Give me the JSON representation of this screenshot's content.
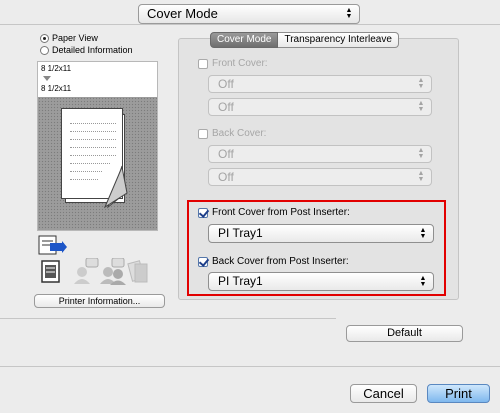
{
  "top_select": {
    "value": "Cover Mode"
  },
  "left": {
    "view_options": [
      {
        "label": "Paper View",
        "selected": true
      },
      {
        "label": "Detailed Information",
        "selected": false
      }
    ],
    "paper_size_1": "8 1/2x11",
    "paper_size_2": "8 1/2x11",
    "printer_info_button": "Printer Information..."
  },
  "tabs": [
    {
      "label": "Cover Mode",
      "selected": true
    },
    {
      "label": "Transparency Interleave",
      "selected": false
    }
  ],
  "front_cover": {
    "label": "Front Cover:",
    "checked": false,
    "select1": "Off",
    "select2": "Off"
  },
  "back_cover": {
    "label": "Back Cover:",
    "checked": false,
    "select1": "Off",
    "select2": "Off"
  },
  "front_post": {
    "label": "Front Cover from Post Inserter:",
    "checked": true,
    "tray": "PI Tray1"
  },
  "back_post": {
    "label": "Back Cover from Post Inserter:",
    "checked": true,
    "tray": "PI Tray1"
  },
  "buttons": {
    "default": "Default",
    "cancel": "Cancel",
    "print": "Print"
  },
  "colors": {
    "highlight_border": "#e20000",
    "print_button": "#9ecdf6"
  }
}
